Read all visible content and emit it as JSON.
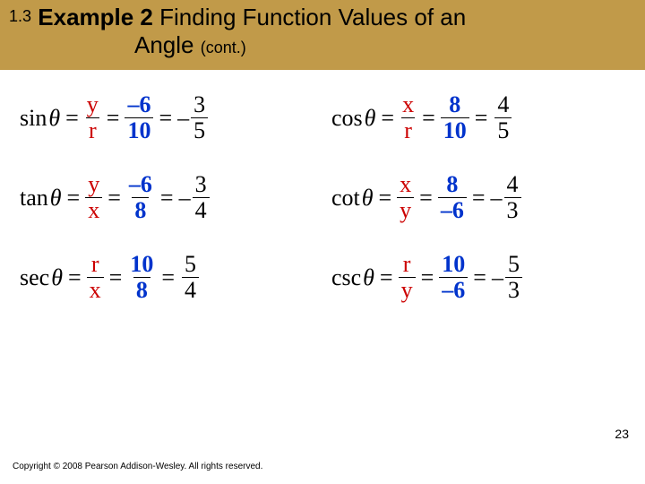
{
  "header": {
    "section": "1.3",
    "pre": "Example 2",
    "title_rest": " Finding Function Values of an",
    "title_line2": "Angle",
    "cont": "(cont.)"
  },
  "vals": {
    "x": "8",
    "y_neg": "–6",
    "r": "10"
  },
  "eqs": {
    "sin": {
      "fn": "sin",
      "varN": "y",
      "varD": "r",
      "n2": "–6",
      "d2": "10",
      "resSign": "–",
      "resN": "3",
      "resD": "5"
    },
    "cos": {
      "fn": "cos",
      "varN": "x",
      "varD": "r",
      "n2": "8",
      "d2": "10",
      "resSign": "",
      "resN": "4",
      "resD": "5"
    },
    "tan": {
      "fn": "tan",
      "varN": "y",
      "varD": "x",
      "n2": "–6",
      "d2": "8",
      "resSign": "–",
      "resN": "3",
      "resD": "4"
    },
    "cot": {
      "fn": "cot",
      "varN": "x",
      "varD": "y",
      "n2": "8",
      "d2": "–6",
      "resSign": "–",
      "resN": "4",
      "resD": "3"
    },
    "sec": {
      "fn": "sec",
      "varN": "r",
      "varD": "x",
      "n2": "10",
      "d2": "8",
      "resSign": "",
      "resN": "5",
      "resD": "4"
    },
    "csc": {
      "fn": "csc",
      "varN": "r",
      "varD": "y",
      "n2": "10",
      "d2": "–6",
      "resSign": "–",
      "resN": "5",
      "resD": "3"
    }
  },
  "page": "23",
  "copyright": "Copyright © 2008 Pearson Addison-Wesley.  All rights reserved."
}
